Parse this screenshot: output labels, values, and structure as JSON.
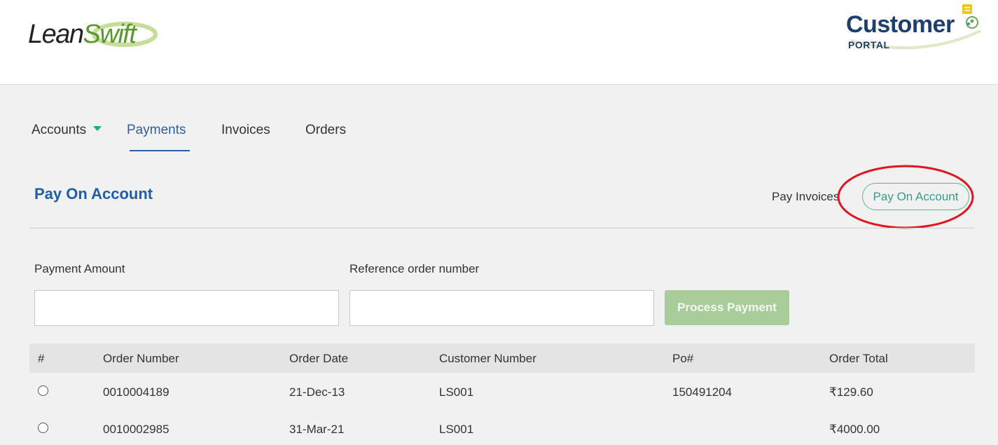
{
  "header": {
    "brand_left": {
      "part1": "Lean",
      "part2": "Swift"
    },
    "brand_right": {
      "title": "Customer",
      "subtitle": "PORTAL"
    }
  },
  "nav": {
    "items": [
      {
        "label": "Accounts",
        "dropdown": true
      },
      {
        "label": "Payments",
        "active": true
      },
      {
        "label": "Invoices"
      },
      {
        "label": "Orders"
      }
    ]
  },
  "page": {
    "title": "Pay On Account",
    "toggle": {
      "pay_invoices": "Pay Invoices",
      "pay_on_account": "Pay On Account"
    }
  },
  "form": {
    "payment_amount": {
      "label": "Payment Amount",
      "value": "",
      "placeholder": ""
    },
    "reference_order": {
      "label": "Reference order number",
      "value": "",
      "placeholder": ""
    },
    "process_button": "Process Payment"
  },
  "table": {
    "columns": [
      "#",
      "Order Number",
      "Order Date",
      "Customer Number",
      "Po#",
      "Order Total"
    ],
    "rows": [
      {
        "order_number": "0010004189",
        "order_date": "21-Dec-13",
        "customer_number": "LS001",
        "po": "150491204",
        "order_total": "₹129.60"
      },
      {
        "order_number": "0010002985",
        "order_date": "31-Mar-21",
        "customer_number": "LS001",
        "po": "",
        "order_total": "₹4000.00"
      }
    ]
  },
  "colors": {
    "accent_blue": "#2d5fa2",
    "title_blue": "#1f5fa8",
    "teal": "#3c9a8a",
    "green_button": "#a9cd9a",
    "highlight_red": "#e0151f",
    "brand_green": "#5a9a2c",
    "brand_navy": "#1e3f6e"
  }
}
